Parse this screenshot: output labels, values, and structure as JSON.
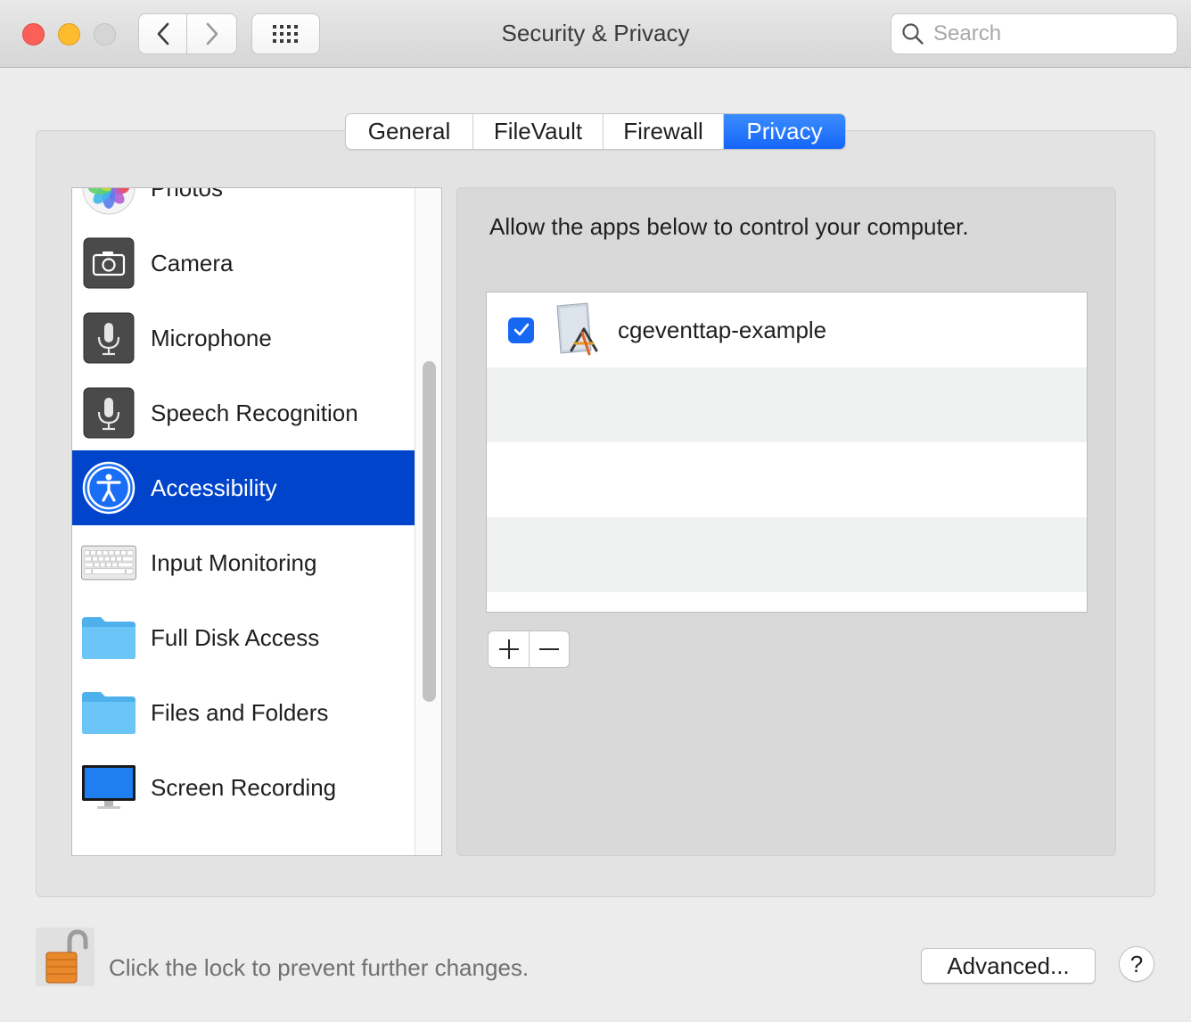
{
  "window": {
    "title": "Security & Privacy"
  },
  "toolbar": {
    "back_icon": "chevron-left-icon",
    "forward_icon": "chevron-right-icon",
    "grid_icon": "show-all-grid-icon"
  },
  "search": {
    "placeholder": "Search",
    "value": ""
  },
  "tabs": [
    {
      "label": "General",
      "active": false
    },
    {
      "label": "FileVault",
      "active": false
    },
    {
      "label": "Firewall",
      "active": false
    },
    {
      "label": "Privacy",
      "active": true
    }
  ],
  "sidebar": {
    "items": [
      {
        "label": "Photos",
        "icon": "photos-icon"
      },
      {
        "label": "Camera",
        "icon": "camera-icon"
      },
      {
        "label": "Microphone",
        "icon": "microphone-icon"
      },
      {
        "label": "Speech Recognition",
        "icon": "speech-recognition-icon"
      },
      {
        "label": "Accessibility",
        "icon": "accessibility-icon",
        "selected": true
      },
      {
        "label": "Input Monitoring",
        "icon": "keyboard-icon"
      },
      {
        "label": "Full Disk Access",
        "icon": "folder-icon"
      },
      {
        "label": "Files and Folders",
        "icon": "folder-icon"
      },
      {
        "label": "Screen Recording",
        "icon": "display-icon"
      }
    ]
  },
  "pane": {
    "description": "Allow the apps below to control your computer.",
    "apps": [
      {
        "name": "cgeventtap-example",
        "checked": true,
        "icon": "app-generic-icon"
      }
    ],
    "add_label": "+",
    "remove_label": "−"
  },
  "footer": {
    "lock_text": "Click the lock to prevent further changes.",
    "advanced_label": "Advanced...",
    "help_label": "?"
  },
  "colors": {
    "accent": "#1566f8",
    "selection": "#0044cc"
  }
}
